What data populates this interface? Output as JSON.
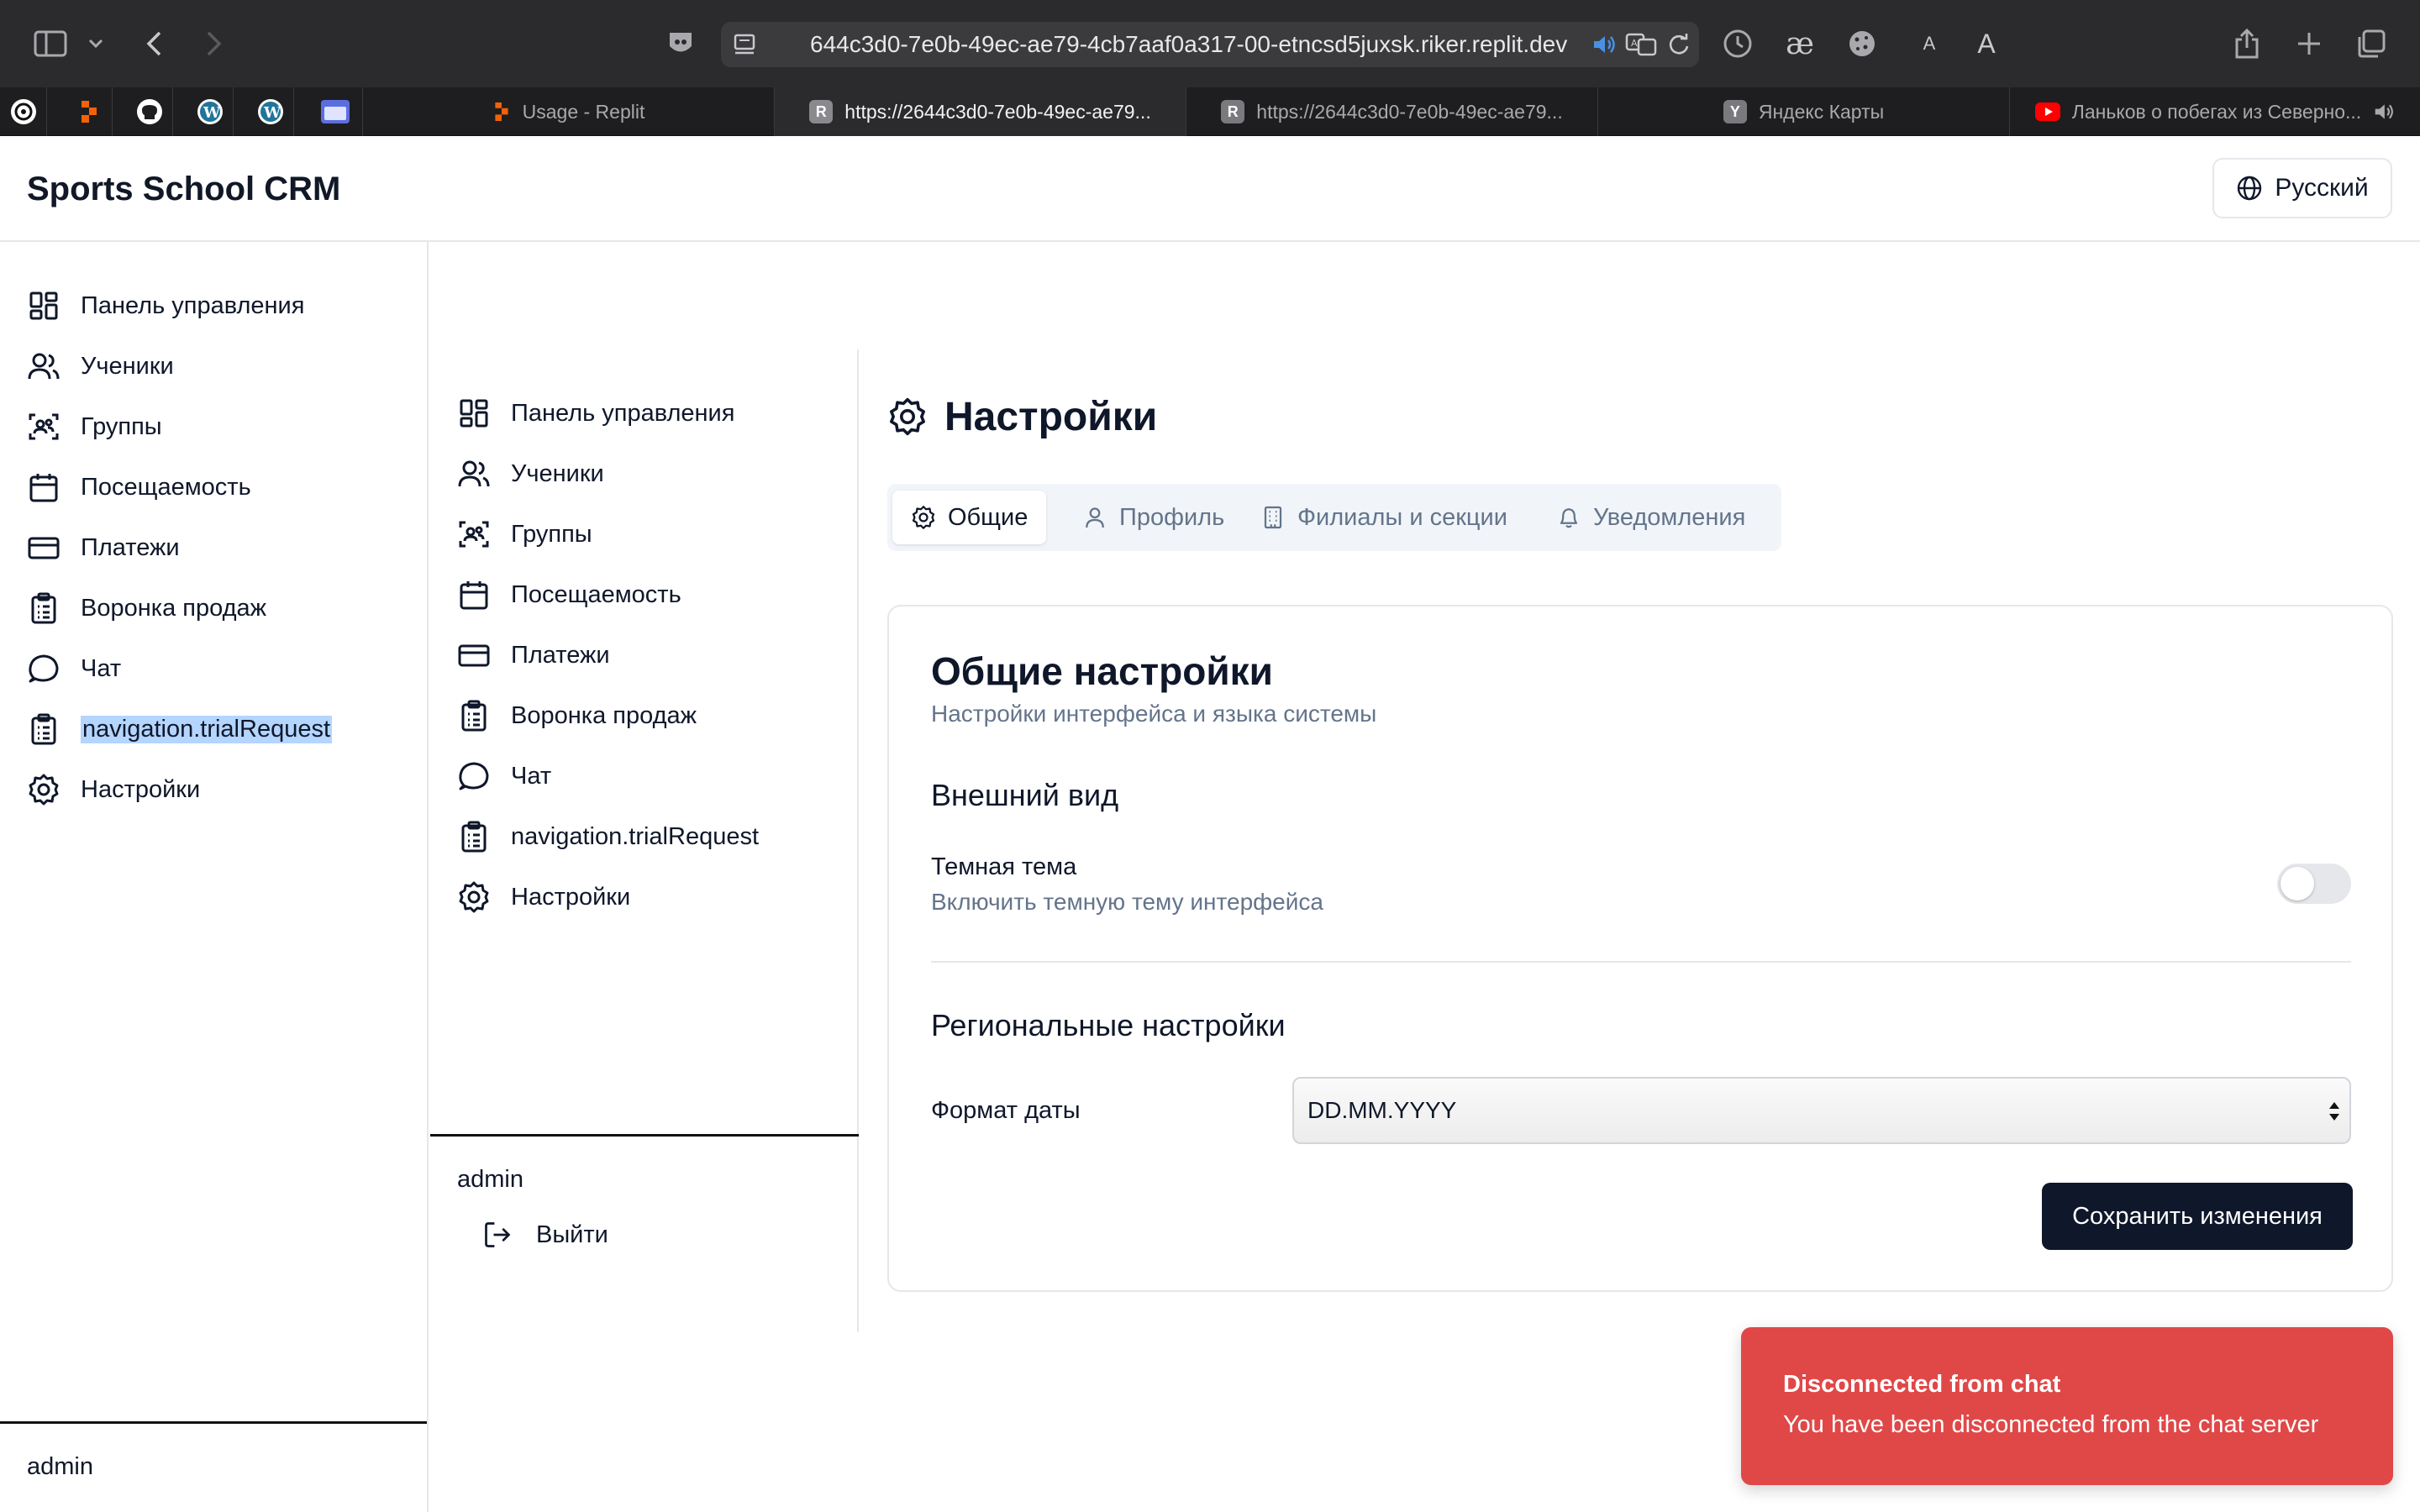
{
  "browser": {
    "url": "644c3d0-7e0b-49ec-ae79-4cb7aaf0a317-00-etncsd5juxsk.riker.replit.dev",
    "font_size_small": "A",
    "font_size_large": "A",
    "tabs": [
      {
        "label": "Usage - Replit",
        "favicon": "replit-icon",
        "active": false
      },
      {
        "label": "https://2644c3d0-7e0b-49ec-ae79...",
        "favicon": "R",
        "active": true
      },
      {
        "label": "https://2644c3d0-7e0b-49ec-ae79...",
        "favicon": "R",
        "active": false
      },
      {
        "label": "Яндекс Карты",
        "favicon": "Y",
        "active": false
      },
      {
        "label": "Ланьков о побегах из Северно...",
        "favicon": "youtube-icon",
        "active": false
      }
    ],
    "pinned": [
      "openai-icon",
      "replit-icon",
      "github-icon",
      "wordpress-icon",
      "wordpress-icon",
      "folder-icon"
    ]
  },
  "app": {
    "title": "Sports School CRM",
    "language_button": "Русский"
  },
  "nav": {
    "items": [
      {
        "label": "Панель управления",
        "icon": "dashboard-icon"
      },
      {
        "label": "Ученики",
        "icon": "users-icon"
      },
      {
        "label": "Группы",
        "icon": "groups-icon"
      },
      {
        "label": "Посещаемость",
        "icon": "calendar-icon"
      },
      {
        "label": "Платежи",
        "icon": "credit-card-icon"
      },
      {
        "label": "Воронка продаж",
        "icon": "clipboard-icon"
      },
      {
        "label": "Чат",
        "icon": "chat-icon"
      },
      {
        "label": "navigation.trialRequest",
        "icon": "clipboard-icon"
      },
      {
        "label": "Настройки",
        "icon": "gear-icon"
      }
    ],
    "user": "admin",
    "logout": "Выйти"
  },
  "settings": {
    "title": "Настройки",
    "tabs": [
      {
        "label": "Общие",
        "icon": "gear-icon",
        "active": true
      },
      {
        "label": "Профиль",
        "icon": "user-icon",
        "active": false
      },
      {
        "label": "Филиалы и секции",
        "icon": "building-icon",
        "active": false
      },
      {
        "label": "Уведомления",
        "icon": "bell-icon",
        "active": false
      }
    ],
    "card": {
      "title": "Общие настройки",
      "subtitle": "Настройки интерфейса и языка системы",
      "appearance_title": "Внешний вид",
      "dark_theme_label": "Темная тема",
      "dark_theme_hint": "Включить темную тему интерфейса",
      "dark_theme_enabled": false,
      "regional_title": "Региональные настройки",
      "date_format_label": "Формат даты",
      "date_format_value": "DD.MM.YYYY",
      "save_button": "Сохранить изменения"
    }
  },
  "toast": {
    "title": "Disconnected from chat",
    "message": "You have been disconnected from the chat server",
    "color": "#e04848"
  }
}
